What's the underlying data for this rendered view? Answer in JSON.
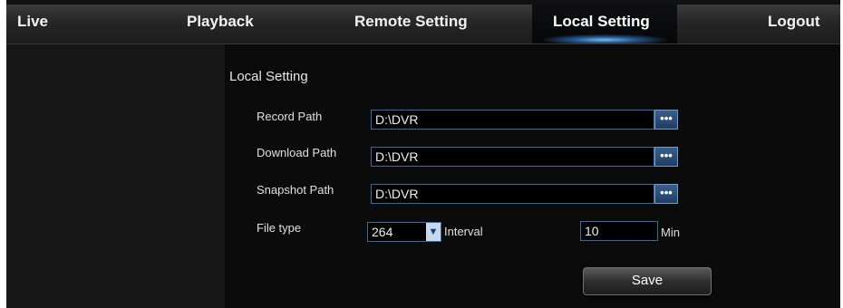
{
  "nav": {
    "live": "Live",
    "playback": "Playback",
    "remote_setting": "Remote Setting",
    "local_setting": "Local Setting",
    "logout": "Logout"
  },
  "section_title": "Local Setting",
  "form": {
    "record_path_label": "Record Path",
    "record_path_value": "D:\\DVR",
    "download_path_label": "Download Path",
    "download_path_value": "D:\\DVR",
    "snapshot_path_label": "Snapshot Path",
    "snapshot_path_value": "D:\\DVR",
    "browse_label": "•••",
    "file_type_label": "File type",
    "file_type_value": "264",
    "interval_label": "Interval",
    "interval_value": "10",
    "interval_unit": "Min"
  },
  "save_label": "Save",
  "colors": {
    "accent": "#2d6fa3",
    "glow": "#78c8ff",
    "background": "#0b0b0b"
  }
}
